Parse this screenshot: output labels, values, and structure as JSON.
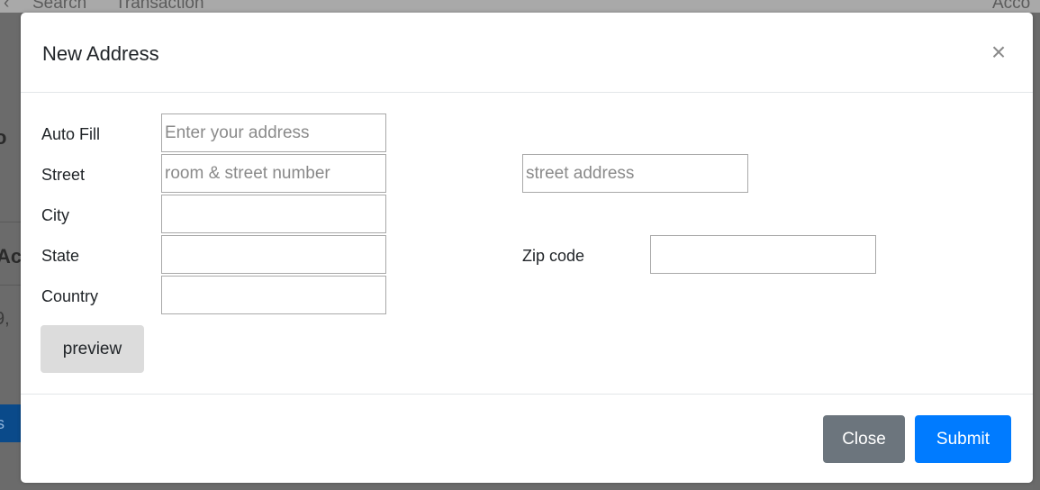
{
  "background": {
    "nav_items": [
      "Search",
      "Transaction",
      "Acco"
    ],
    "side_fragments": [
      "o",
      "Ac",
      "9,",
      "s"
    ]
  },
  "modal": {
    "title": "New Address",
    "close_symbol": "×",
    "fields": {
      "auto_fill": {
        "label": "Auto Fill",
        "value": "",
        "placeholder": "Enter your address"
      },
      "street_number": {
        "label": "Street",
        "value": "",
        "placeholder": "room & street number"
      },
      "street_address": {
        "value": "",
        "placeholder": "street address"
      },
      "city": {
        "label": "City",
        "value": "",
        "placeholder": ""
      },
      "state": {
        "label": "State",
        "value": "",
        "placeholder": ""
      },
      "zip": {
        "label": "Zip code",
        "value": "",
        "placeholder": ""
      },
      "country": {
        "label": "Country",
        "value": "",
        "placeholder": ""
      }
    },
    "preview_label": "preview",
    "footer": {
      "close_label": "Close",
      "submit_label": "Submit"
    }
  },
  "colors": {
    "backdrop": "#6b6b6b",
    "close_button": "#6c757d",
    "submit_button": "#007bff",
    "preview_button": "#dcdcdc"
  }
}
